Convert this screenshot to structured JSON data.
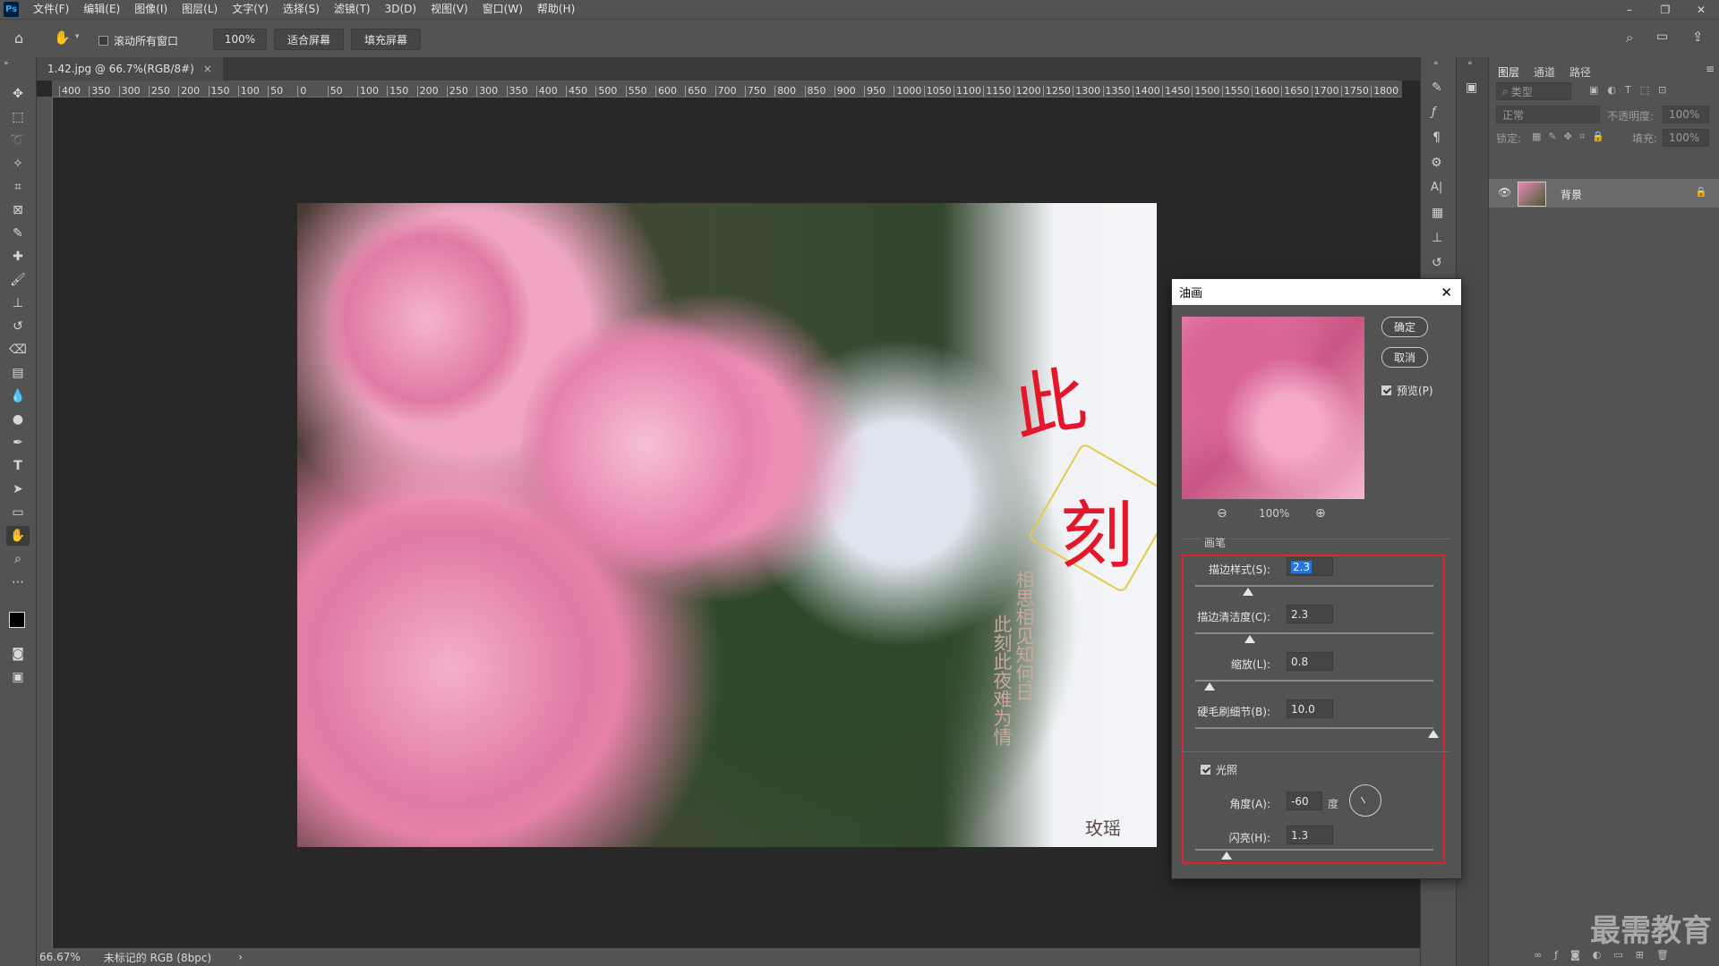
{
  "app": {
    "logo": "Ps"
  },
  "menu": [
    "文件(F)",
    "编辑(E)",
    "图像(I)",
    "图层(L)",
    "文字(Y)",
    "选择(S)",
    "滤镜(T)",
    "3D(D)",
    "视图(V)",
    "窗口(W)",
    "帮助(H)"
  ],
  "window_controls": {
    "minimize": "–",
    "restore": "❐",
    "close": "✕"
  },
  "options": {
    "scroll_all_label": "滚动所有窗口",
    "zoom_value": "100%",
    "fit_screen": "适合屏幕",
    "fill_screen": "填充屏幕"
  },
  "document": {
    "tab_title": "1.42.jpg @ 66.7%(RGB/8#)",
    "tab_close": "×",
    "image_text": {
      "title1": "此",
      "title2": "刻",
      "poem_col1": "相思相见知何日",
      "poem_col2": "此刻此夜难为情",
      "signature": "玫瑶"
    }
  },
  "ruler_top_labels": [
    "400",
    "350",
    "300",
    "250",
    "200",
    "150",
    "100",
    "50",
    "0",
    "50",
    "100",
    "150",
    "200",
    "250",
    "300",
    "350",
    "400",
    "450",
    "500",
    "550",
    "600",
    "650",
    "700",
    "750",
    "800",
    "850",
    "900",
    "950",
    "1000",
    "1050",
    "1100",
    "1150",
    "1200",
    "1250",
    "1300",
    "1350",
    "1400",
    "1450",
    "1500",
    "1550",
    "1600",
    "1650",
    "1700",
    "1750",
    "1800"
  ],
  "status": {
    "zoom": "66.67%",
    "profile": "未标记的 RGB (8bpc)",
    "arrow": "›"
  },
  "layers_panel": {
    "tabs": [
      "图层",
      "通道",
      "路径"
    ],
    "search_placeholder": "类型",
    "blend_mode": "正常",
    "opacity_label": "不透明度:",
    "opacity_value": "100%",
    "lock_label": "锁定:",
    "fill_label": "填充:",
    "fill_value": "100%",
    "layer_name": "背景"
  },
  "dialog": {
    "title": "油画",
    "ok": "确定",
    "cancel": "取消",
    "preview_label": "预览(P)",
    "preview_zoom": "100%",
    "brush_section": "画笔",
    "stylization_label": "描边样式(S):",
    "stylization_value": "2.3",
    "cleanliness_label": "描边清洁度(C):",
    "cleanliness_value": "2.3",
    "scale_label": "缩放(L):",
    "scale_value": "0.8",
    "bristle_label": "硬毛刷细节(B):",
    "bristle_value": "10.0",
    "lighting_label": "光照",
    "angle_label": "角度(A):",
    "angle_value": "-60",
    "angle_unit": "度",
    "shine_label": "闪亮(H):",
    "shine_value": "1.3",
    "slider_positions": {
      "stylization": 0.22,
      "cleanliness": 0.23,
      "scale": 0.06,
      "bristle": 1.0,
      "shine": 0.13
    }
  },
  "watermark": "最需教育"
}
